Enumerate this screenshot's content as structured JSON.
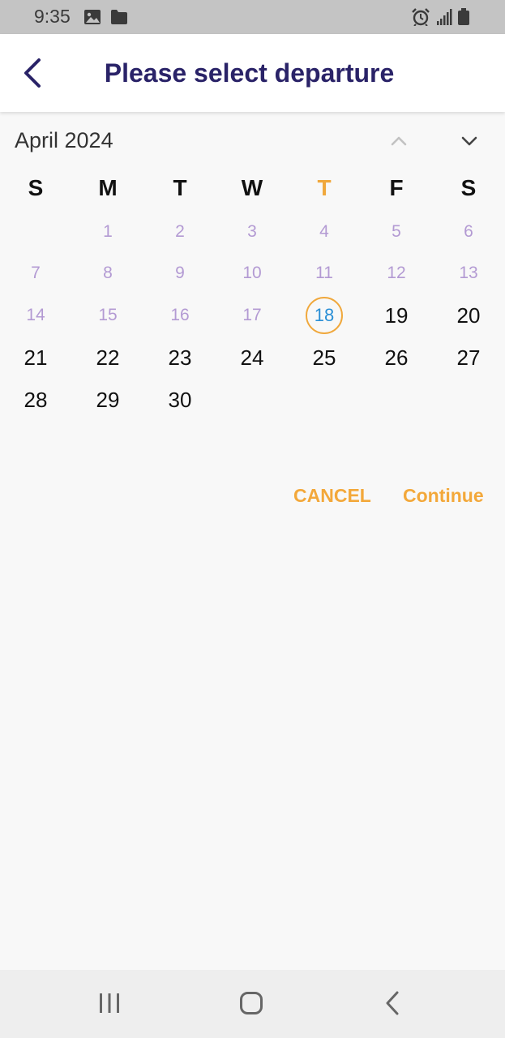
{
  "status_bar": {
    "time": "9:35",
    "left_icons": [
      "image-icon",
      "folder-icon"
    ],
    "right_icons": [
      "alarm-icon",
      "signal-icon",
      "battery-icon"
    ]
  },
  "header": {
    "title": "Please select departure",
    "back_icon": "chevron-left-icon",
    "title_color": "#2a2368"
  },
  "calendar": {
    "month_year": "April 2024",
    "weekdays": [
      "S",
      "M",
      "T",
      "W",
      "T",
      "F",
      "S"
    ],
    "today_weekday_color": "#f0a83c",
    "today": "18",
    "rows": [
      [
        "",
        "1",
        "2",
        "3",
        "4",
        "5",
        "6"
      ],
      [
        "7",
        "8",
        "9",
        "10",
        "11",
        "12",
        "13"
      ],
      [
        "14",
        "15",
        "16",
        "17",
        "18",
        "19",
        "20"
      ],
      [
        "21",
        "22",
        "23",
        "24",
        "25",
        "26",
        "27"
      ],
      [
        "28",
        "29",
        "30",
        "",
        "",
        "",
        ""
      ]
    ],
    "disabled_color": "#b39ad3",
    "today_color": "#2a8fd6"
  },
  "actions": {
    "cancel_label": "CANCEL",
    "continue_label": "Continue",
    "accent_color": "#f3a83a"
  },
  "nav_bar": {
    "icons": [
      "recent-apps-icon",
      "home-icon",
      "back-icon"
    ]
  }
}
